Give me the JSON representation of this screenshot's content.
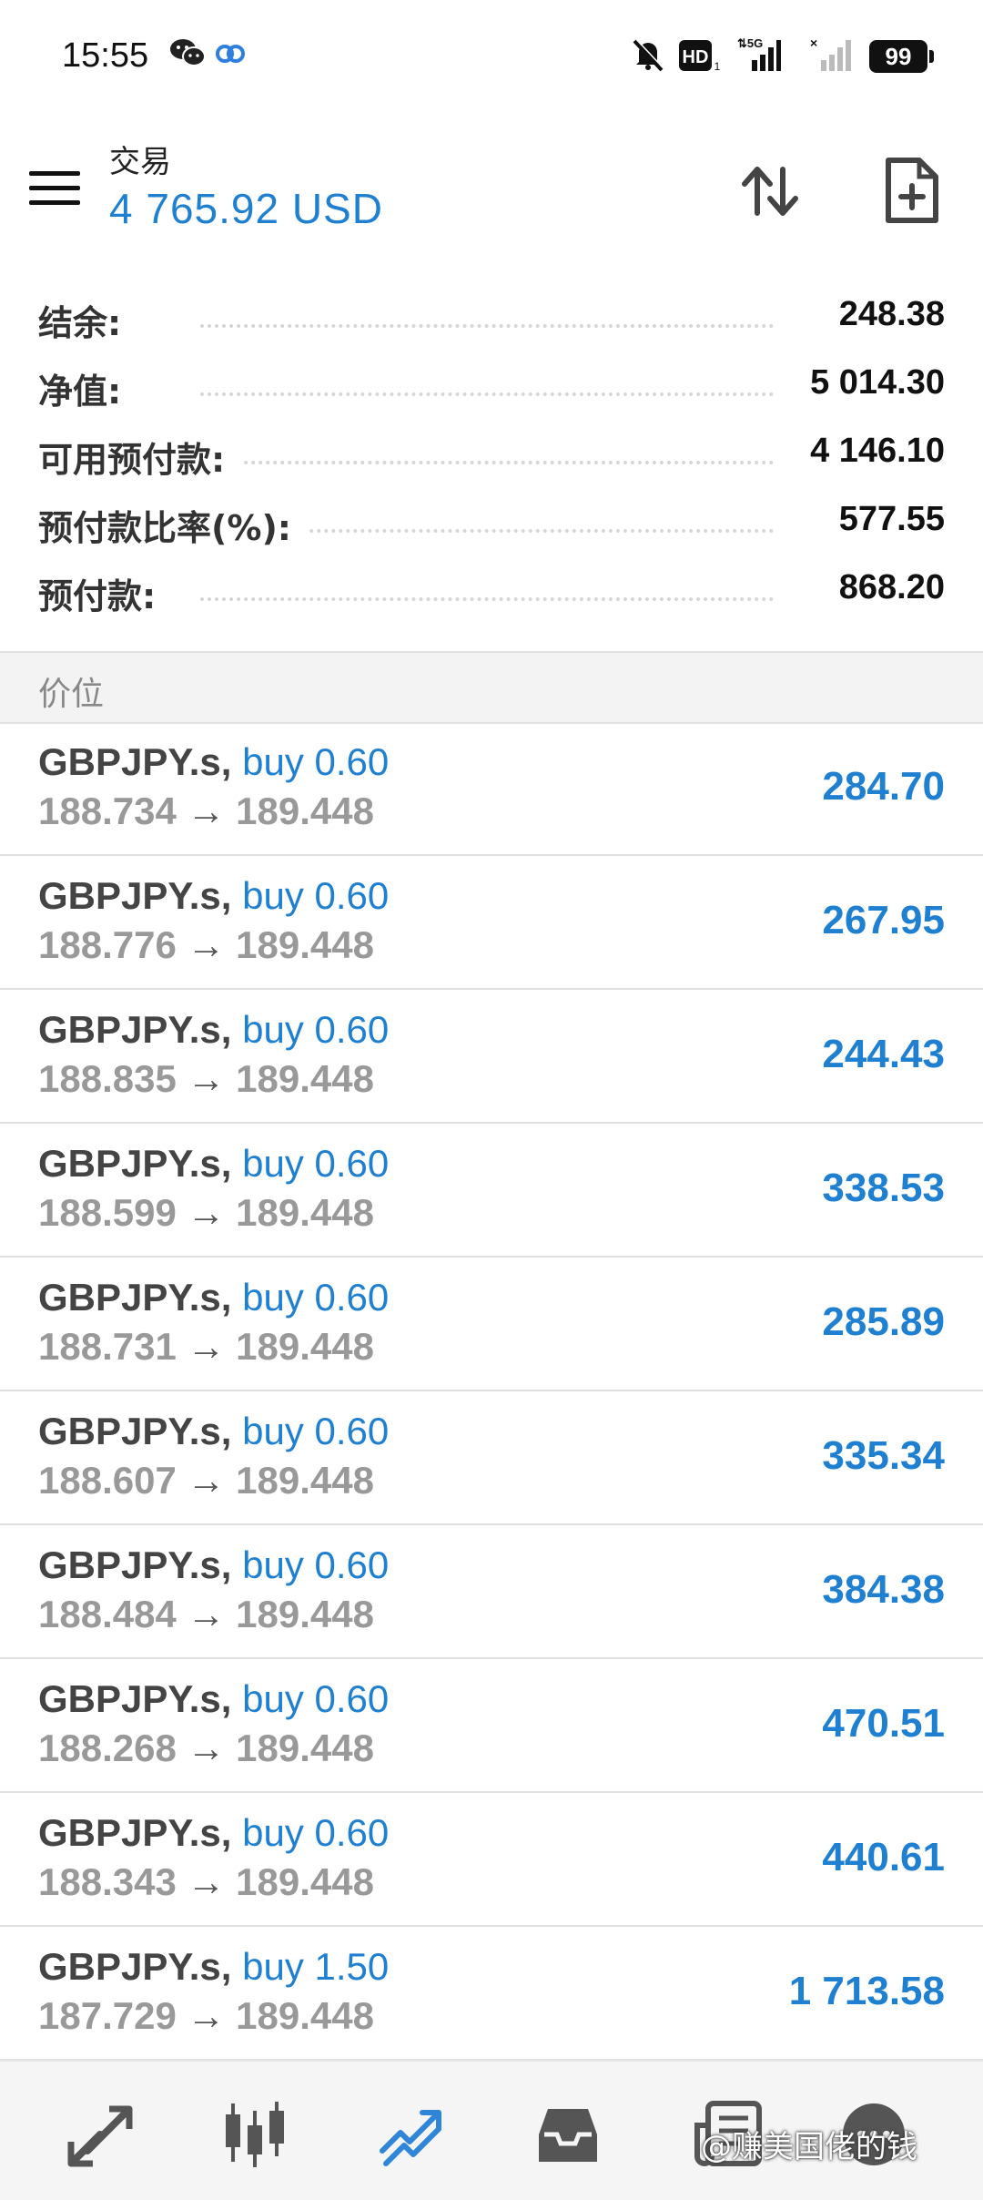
{
  "status_bar": {
    "time": "15:55",
    "icons": [
      "wechat-icon",
      "cloud-link-icon",
      "mute-bell-icon",
      "hd-icon",
      "signal-5g-icon",
      "signal-no-sim-icon"
    ],
    "battery": "99"
  },
  "header": {
    "title": "交易",
    "balance_line": "4 765.92 USD",
    "icons": [
      "sort-arrows-icon",
      "new-order-icon",
      "menu-icon"
    ]
  },
  "summary": [
    {
      "label": "结余:",
      "value": "248.38"
    },
    {
      "label": "净值:",
      "value": "5 014.30"
    },
    {
      "label": "可用预付款:",
      "value": "4 146.10"
    },
    {
      "label": "预付款比率(%):",
      "value": "577.55"
    },
    {
      "label": "预付款:",
      "value": "868.20"
    }
  ],
  "section_title": "价位",
  "positions": [
    {
      "symbol": "GBPJPY.s,",
      "type": "buy 0.60",
      "open": "188.734",
      "arrow": "→",
      "current": "189.448",
      "profit": "284.70"
    },
    {
      "symbol": "GBPJPY.s,",
      "type": "buy 0.60",
      "open": "188.776",
      "arrow": "→",
      "current": "189.448",
      "profit": "267.95"
    },
    {
      "symbol": "GBPJPY.s,",
      "type": "buy 0.60",
      "open": "188.835",
      "arrow": "→",
      "current": "189.448",
      "profit": "244.43"
    },
    {
      "symbol": "GBPJPY.s,",
      "type": "buy 0.60",
      "open": "188.599",
      "arrow": "→",
      "current": "189.448",
      "profit": "338.53"
    },
    {
      "symbol": "GBPJPY.s,",
      "type": "buy 0.60",
      "open": "188.731",
      "arrow": "→",
      "current": "189.448",
      "profit": "285.89"
    },
    {
      "symbol": "GBPJPY.s,",
      "type": "buy 0.60",
      "open": "188.607",
      "arrow": "→",
      "current": "189.448",
      "profit": "335.34"
    },
    {
      "symbol": "GBPJPY.s,",
      "type": "buy 0.60",
      "open": "188.484",
      "arrow": "→",
      "current": "189.448",
      "profit": "384.38"
    },
    {
      "symbol": "GBPJPY.s,",
      "type": "buy 0.60",
      "open": "188.268",
      "arrow": "→",
      "current": "189.448",
      "profit": "470.51"
    },
    {
      "symbol": "GBPJPY.s,",
      "type": "buy 0.60",
      "open": "188.343",
      "arrow": "→",
      "current": "189.448",
      "profit": "440.61"
    },
    {
      "symbol": "GBPJPY.s,",
      "type": "buy 1.50",
      "open": "187.729",
      "arrow": "→",
      "current": "189.448",
      "profit": "1 713.58"
    }
  ],
  "bottom_nav": [
    "quotes-icon",
    "chart-candles-icon",
    "trade-icon",
    "history-icon",
    "news-icon",
    "chat-icon"
  ],
  "colors": {
    "accent": "#1f80d2",
    "profit": "#1f80d2",
    "label": "#333333"
  },
  "watermark": "@赚美国佬的钱"
}
